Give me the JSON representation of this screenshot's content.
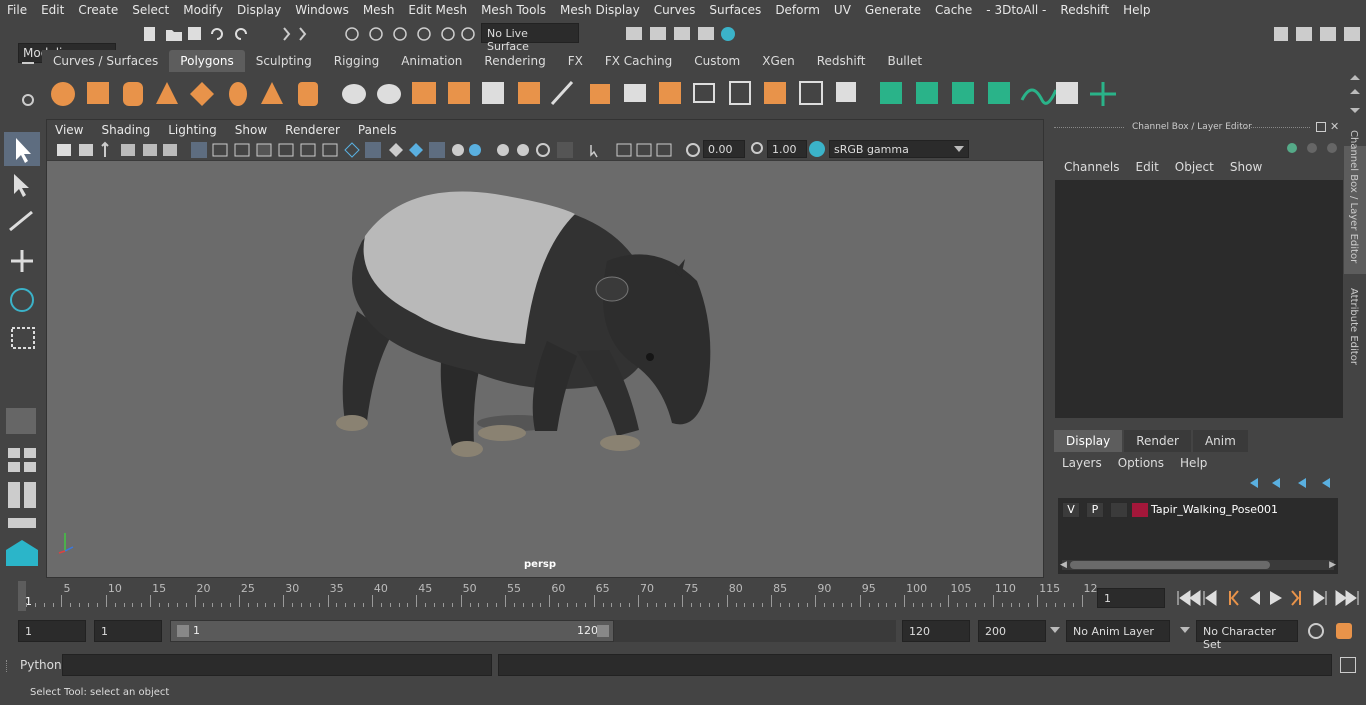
{
  "menubar": [
    "File",
    "Edit",
    "Create",
    "Select",
    "Modify",
    "Display",
    "Windows",
    "Mesh",
    "Edit Mesh",
    "Mesh Tools",
    "Mesh Display",
    "Curves",
    "Surfaces",
    "Deform",
    "UV",
    "Generate",
    "Cache",
    "- 3DtoAll -",
    "Redshift",
    "Help"
  ],
  "status": {
    "mode": "Modeling",
    "live_surface": "No Live Surface"
  },
  "shelf_tabs": [
    "Curves / Surfaces",
    "Polygons",
    "Sculpting",
    "Rigging",
    "Animation",
    "Rendering",
    "FX",
    "FX Caching",
    "Custom",
    "XGen",
    "Redshift",
    "Bullet"
  ],
  "shelf_active": "Polygons",
  "viewport": {
    "menu": [
      "View",
      "Shading",
      "Lighting",
      "Show",
      "Renderer",
      "Panels"
    ],
    "exposure": "0.00",
    "gamma": "1.00",
    "colorspace": "sRGB gamma",
    "camera_label": "persp"
  },
  "channel_box": {
    "title": "Channel Box / Layer Editor",
    "menu": [
      "Channels",
      "Edit",
      "Object",
      "Show"
    ]
  },
  "layer_editor": {
    "tabs": [
      "Display",
      "Render",
      "Anim"
    ],
    "active_tab": "Display",
    "menu": [
      "Layers",
      "Options",
      "Help"
    ],
    "layers": [
      {
        "v": "V",
        "p": "P",
        "color": "#a3173a",
        "name": "Tapir_Walking_Pose001"
      }
    ]
  },
  "side_tabs": [
    "Channel Box / Layer Editor",
    "Attribute Editor"
  ],
  "timeline": {
    "ticks": [
      "5",
      "10",
      "15",
      "20",
      "25",
      "30",
      "35",
      "40",
      "45",
      "50",
      "55",
      "60",
      "65",
      "70",
      "75",
      "80",
      "85",
      "90",
      "95",
      "100",
      "105",
      "110",
      "115",
      "12"
    ],
    "start_label": "1",
    "current_frame": "1"
  },
  "range": {
    "start": "1",
    "playback_start": "1",
    "slider_start": "1",
    "slider_end": "120",
    "playback_end": "120",
    "end": "200",
    "anim_layer": "No Anim Layer",
    "character_set": "No Character Set"
  },
  "command": {
    "label": "Python"
  },
  "help_line": "Select Tool: select an object",
  "colors": {
    "bg": "#444444",
    "viewport": "#6b6b6b",
    "shelf_orange": "#e8934a",
    "shelf_green": "#2ab389"
  }
}
